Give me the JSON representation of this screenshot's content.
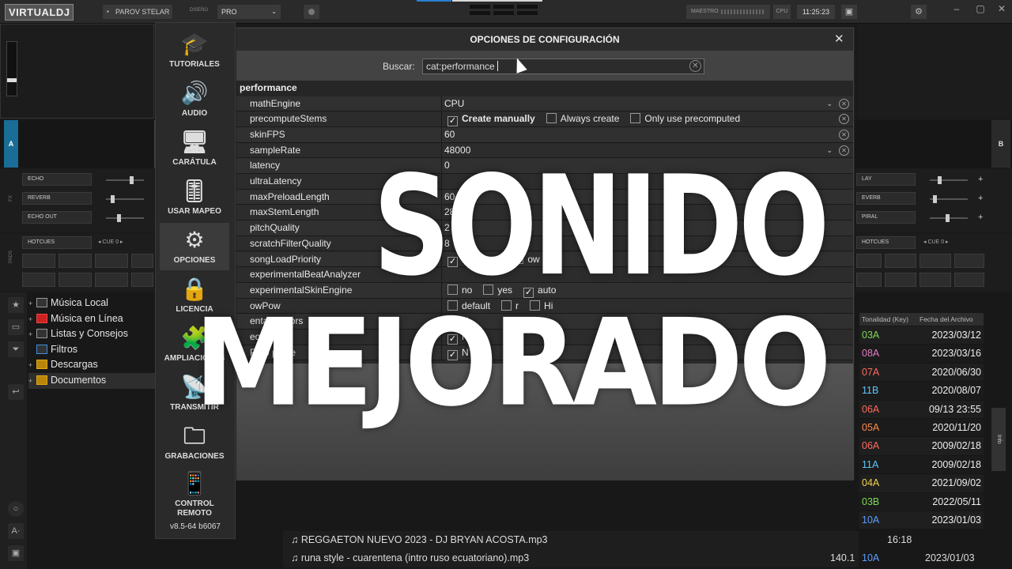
{
  "app": {
    "logo": "VIRTUALDJ",
    "user": "PAROV STELAR",
    "design_label": "DISEÑO",
    "skin": "PRO",
    "master_label": "MAESTRO",
    "cpu_label": "CPU",
    "clock": "11:25:23"
  },
  "decks": {
    "left_letter": "A",
    "right_letter": "B",
    "left_fx": [
      "ECHO",
      "REVERB",
      "ECHO OUT"
    ],
    "right_fx": [
      "LAY",
      "EVERB",
      "PIRAL"
    ],
    "left_pads_mode": "HOTCUES",
    "left_cue_label": "CUE 0",
    "right_pads_mode": "HOTCUES",
    "right_cue_label": "CUE 0",
    "fx_side": "FX",
    "pads_side": "PADS"
  },
  "browser": {
    "folders": [
      {
        "label": "Música Local",
        "icon": "computer-icon"
      },
      {
        "label": "Música en Línea",
        "icon": "online-icon"
      },
      {
        "label": "Listas y Consejos",
        "icon": "list-icon"
      },
      {
        "label": "Filtros",
        "icon": "filter-icon"
      },
      {
        "label": "Descargas",
        "icon": "star-folder-icon"
      },
      {
        "label": "Documentos",
        "icon": "star-folder-icon"
      }
    ],
    "columns": {
      "key": "Tonalidad (Key)",
      "date": "Fecha del Archivo"
    },
    "rows": [
      {
        "key": "03A",
        "date": "2023/03/12",
        "color": "#7ed957"
      },
      {
        "key": "08A",
        "date": "2023/03/16",
        "color": "#e27ac5"
      },
      {
        "key": "07A",
        "date": "2020/06/30",
        "color": "#ff6a5c"
      },
      {
        "key": "11B",
        "date": "2020/08/07",
        "color": "#5cc7ff"
      },
      {
        "key": "06A",
        "date": "09/13 23:55",
        "color": "#ff6a5c"
      },
      {
        "key": "05A",
        "date": "2020/11/20",
        "color": "#ff8a4a"
      },
      {
        "key": "06A",
        "date": "2009/02/18",
        "color": "#ff6a5c"
      },
      {
        "key": "11A",
        "date": "2009/02/18",
        "color": "#5cc7ff"
      },
      {
        "key": "04A",
        "date": "2021/09/02",
        "color": "#f2d24a"
      },
      {
        "key": "03B",
        "date": "2022/05/11",
        "color": "#7ed957"
      },
      {
        "key": "10A",
        "date": "2023/01/03",
        "color": "#5c9dff"
      }
    ],
    "files": [
      {
        "name": "♫ REGGAETON NUEVO 2023 - DJ BRYAN ACOSTA.mp3",
        "bpm": "",
        "key": "",
        "date": "16:18"
      },
      {
        "name": "♫ runa style - cuarentena (intro ruso ecuatoriano).mp3",
        "bpm": "140.1",
        "key": "10A",
        "date": "2023/01/03"
      }
    ],
    "side_tab": "Info"
  },
  "options": {
    "title": "OPCIONES DE CONFIGURACIÓN",
    "search_label": "Buscar:",
    "search_value": "cat:performance",
    "category": "performance",
    "nav": [
      {
        "label": "TUTORIALES",
        "icon": "graduation-cap-icon"
      },
      {
        "label": "AUDIO",
        "icon": "speaker-icon"
      },
      {
        "label": "CARÁTULA",
        "icon": "monitor-icon"
      },
      {
        "label": "USAR MAPEO",
        "icon": "sliders-icon"
      },
      {
        "label": "OPCIONES",
        "icon": "gear-icon"
      },
      {
        "label": "LICENCIA",
        "icon": "lock-icon"
      },
      {
        "label": "AMPLIACIONES",
        "icon": "puzzle-icon"
      },
      {
        "label": "TRANSMITIR",
        "icon": "broadcast-icon"
      },
      {
        "label": "GRABACIONES",
        "icon": "folder-music-icon"
      },
      {
        "label": "CONTROL REMOTO",
        "icon": "phone-icon"
      }
    ],
    "version": "v8.5-64 b6067",
    "rows": [
      {
        "name": "mathEngine",
        "value": "CPU",
        "dropdown": true
      },
      {
        "name": "precomputeStems",
        "value": "",
        "opts": [
          {
            "label": "Create manually",
            "checked": true,
            "bold": true
          },
          {
            "label": "Always create",
            "checked": false
          },
          {
            "label": "Only use precomputed",
            "checked": false
          }
        ]
      },
      {
        "name": "skinFPS",
        "value": "60"
      },
      {
        "name": "sampleRate",
        "value": "48000",
        "dropdown": true
      },
      {
        "name": "latency",
        "value": "0"
      },
      {
        "name": "ultraLatency",
        "value": ""
      },
      {
        "name": "maxPreloadLength",
        "value": "60"
      },
      {
        "name": "maxStemLength",
        "value": "28"
      },
      {
        "name": "pitchQuality",
        "value": "2"
      },
      {
        "name": "scratchFilterQuality",
        "value": "8"
      },
      {
        "name": "songLoadPriority",
        "value": "",
        "opts": [
          {
            "label": "",
            "checked": true
          },
          {
            "label": "mal",
            "checked": false
          },
          {
            "label": "ow",
            "checked": false
          }
        ]
      },
      {
        "name": "experimentalBeatAnalyzer",
        "value": ""
      },
      {
        "name": "experimentalSkinEngine",
        "value": "",
        "opts": [
          {
            "label": "no",
            "checked": false
          },
          {
            "label": "yes",
            "checked": false
          },
          {
            "label": "auto",
            "checked": true
          }
        ]
      },
      {
        "name": "owPow",
        "value": "",
        "opts": [
          {
            "label": "default",
            "checked": false
          },
          {
            "label": "r",
            "checked": false
          },
          {
            "label": "Hi",
            "checked": false
          }
        ]
      },
      {
        "name": "entaleColors",
        "value": "",
        "opts": [
          {
            "label": "N",
            "checked": true
          }
        ]
      },
      {
        "name": "eoD",
        "value": "",
        "opts": [
          {
            "label": "N",
            "checked": true
          }
        ]
      },
      {
        "name": "PMo pdate",
        "value": "",
        "opts": [
          {
            "label": "N",
            "checked": true
          }
        ]
      }
    ]
  },
  "overlay": {
    "line1": "SONIDO",
    "line2": "MEJORADO"
  }
}
